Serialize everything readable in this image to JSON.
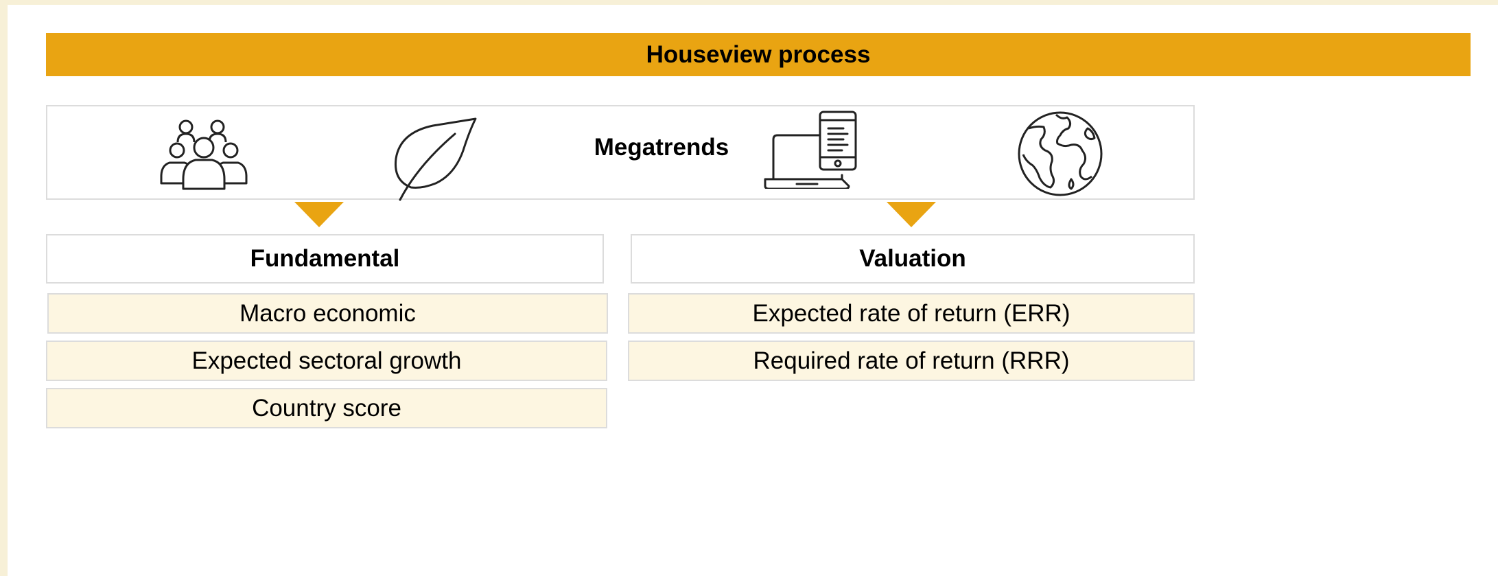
{
  "banner": {
    "title": "Houseview process"
  },
  "megatrends": {
    "title": "Megatrends",
    "icons": [
      "people-group-icon",
      "leaf-icon",
      "laptop-phone-icon",
      "globe-icon"
    ]
  },
  "fundamental": {
    "title": "Fundamental",
    "items": [
      "Macro economic",
      "Expected sectoral growth",
      "Country score"
    ]
  },
  "valuation": {
    "title": "Valuation",
    "items": [
      "Expected rate of return (ERR)",
      "Required rate of return (RRR)"
    ]
  },
  "colors": {
    "accent": "#e9a412",
    "item_bg": "#fdf6e1",
    "page_bg": "#f7f0d7",
    "border": "#dcdcdc"
  }
}
